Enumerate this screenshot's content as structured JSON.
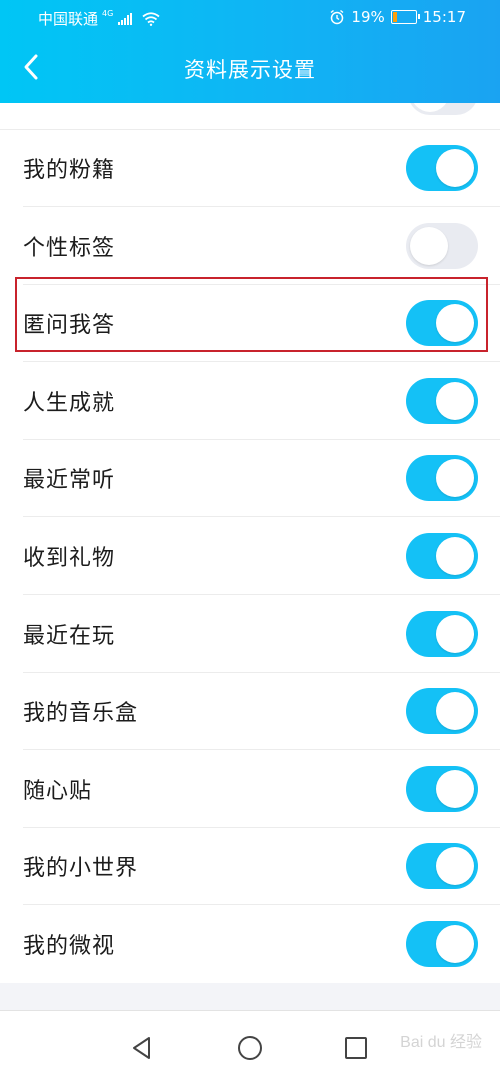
{
  "status_bar": {
    "carrier": "中国联通",
    "network": "4G",
    "alarm_icon": "alarm-icon",
    "battery_percent": "19%",
    "battery_level": 0.19,
    "time": "15:17"
  },
  "header": {
    "title": "资料展示设置",
    "back_icon": "chevron-left-icon"
  },
  "colors": {
    "header_gradient_start": "#00c6f5",
    "header_gradient_end": "#1aa3f2",
    "toggle_on": "#14c1f6",
    "toggle_off": "#e9ebf1",
    "highlight_border": "#c8232c"
  },
  "partial_top_toggle_on": false,
  "settings": [
    {
      "label": "我的粉籍",
      "on": true
    },
    {
      "label": "个性标签",
      "on": false
    },
    {
      "label": "匿问我答",
      "on": true,
      "highlighted": true
    },
    {
      "label": "人生成就",
      "on": true
    },
    {
      "label": "最近常听",
      "on": true
    },
    {
      "label": "收到礼物",
      "on": true
    },
    {
      "label": "最近在玩",
      "on": true
    },
    {
      "label": "我的音乐盒",
      "on": true
    },
    {
      "label": "随心贴",
      "on": true
    },
    {
      "label": "我的小世界",
      "on": true
    },
    {
      "label": "我的微视",
      "on": true
    }
  ],
  "nav_bar": {
    "back_icon": "triangle-back-icon",
    "home_icon": "circle-home-icon",
    "recents_icon": "square-recents-icon"
  },
  "watermark": "Bai du 经验"
}
